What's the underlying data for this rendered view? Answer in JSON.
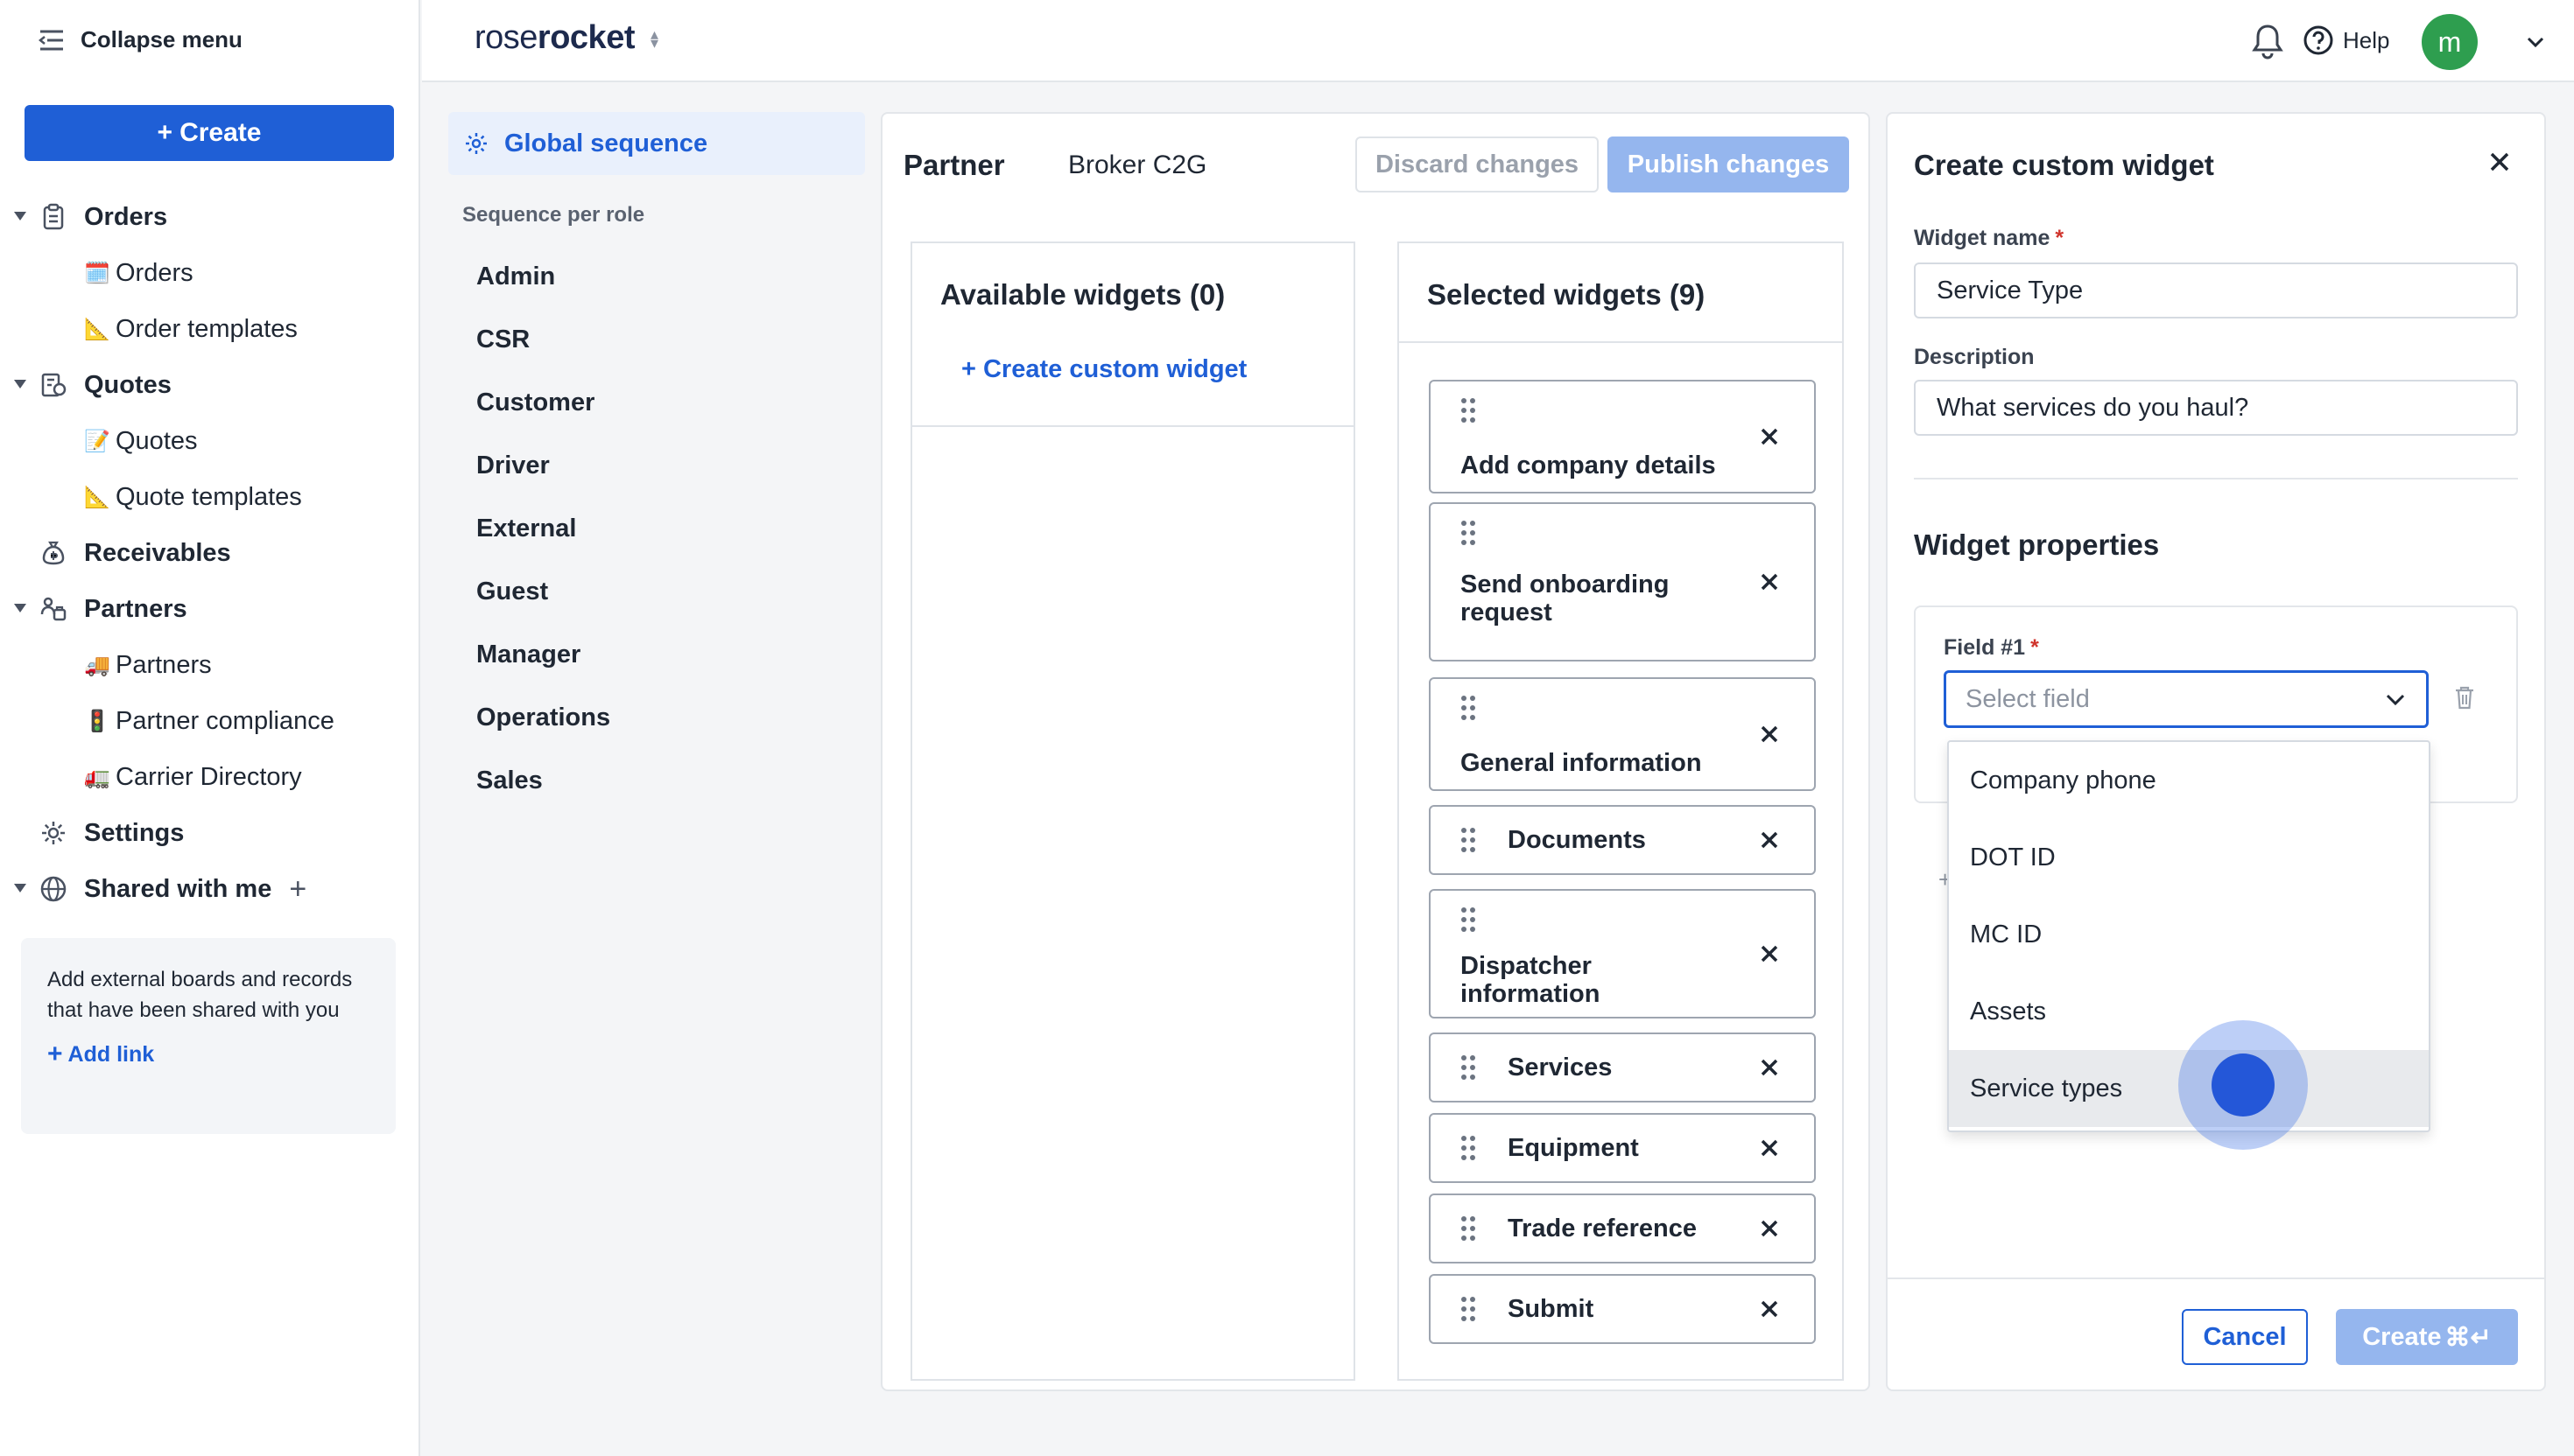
{
  "nav": {
    "collapse_label": "Collapse menu",
    "create_label": "Create",
    "items": [
      {
        "label": "Orders",
        "level": "top",
        "icon": "clipboard-icon",
        "caret": true
      },
      {
        "label": "Orders",
        "level": "sub",
        "emoji": "🗓️"
      },
      {
        "label": "Order templates",
        "level": "sub",
        "emoji": "📐"
      },
      {
        "label": "Quotes",
        "level": "top",
        "icon": "quote-icon",
        "caret": true
      },
      {
        "label": "Quotes",
        "level": "sub",
        "emoji": "📝"
      },
      {
        "label": "Quote templates",
        "level": "sub",
        "emoji": "📐"
      },
      {
        "label": "Receivables",
        "level": "top",
        "icon": "money-bag-icon",
        "caret": false
      },
      {
        "label": "Partners",
        "level": "top",
        "icon": "partners-icon",
        "caret": true
      },
      {
        "label": "Partners",
        "level": "sub",
        "emoji": "🚚"
      },
      {
        "label": "Partner compliance",
        "level": "sub",
        "emoji": "🚦"
      },
      {
        "label": "Carrier Directory",
        "level": "sub",
        "emoji": "🚛"
      },
      {
        "label": "Settings",
        "level": "top",
        "icon": "gear-icon",
        "caret": false
      },
      {
        "label": "Shared with me",
        "level": "top",
        "icon": "globe-icon",
        "caret": true,
        "plus": true
      }
    ],
    "shared_box": {
      "text": "Add external boards and records that have been shared with you",
      "add_link": "Add link"
    }
  },
  "header": {
    "logo_left": "rose",
    "logo_right": "rocket",
    "help_label": "Help",
    "avatar_initial": "m"
  },
  "sequence": {
    "global_label": "Global sequence",
    "per_role_heading": "Sequence per role",
    "roles": [
      "Admin",
      "CSR",
      "Customer",
      "Driver",
      "External",
      "Guest",
      "Manager",
      "Operations",
      "Sales"
    ]
  },
  "main": {
    "title": "Partner",
    "subtitle": "Broker C2G",
    "discard_label": "Discard changes",
    "publish_label": "Publish changes",
    "available_title": "Available widgets (0)",
    "create_custom_label": "+ Create custom widget",
    "selected_title": "Selected widgets (9)",
    "selected_widgets": [
      "Add company details",
      "Send onboarding request",
      "General information",
      "Documents",
      "Dispatcher information",
      "Services",
      "Equipment",
      "Trade reference",
      "Submit"
    ]
  },
  "panel": {
    "title": "Create custom widget",
    "widget_name_label": "Widget name",
    "widget_name_value": "Service Type",
    "description_label": "Description",
    "description_value": "What services do you haul?",
    "properties_title": "Widget properties",
    "field_label": "Field #1",
    "select_placeholder": "Select field",
    "plus_hint": "+",
    "options": [
      "Company phone",
      "DOT ID",
      "MC ID",
      "Assets",
      "Service types"
    ],
    "highlighted_option": "Service types",
    "cancel_label": "Cancel",
    "create_label": "Create",
    "create_shortcut": "⌘↵"
  },
  "colors": {
    "primary": "#1f5fd6",
    "primary_disabled": "#95b6ee",
    "avatar": "#2e9e4f",
    "required": "#d0342c"
  }
}
